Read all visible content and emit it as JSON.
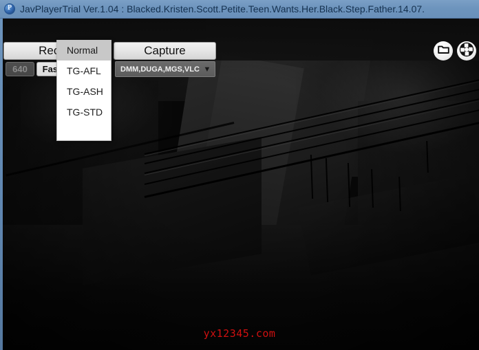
{
  "window": {
    "title": "JavPlayerTrial Ver.1.04 : Blacked.Kristen.Scott.Petite.Teen.Wants.Her.Black.Step.Father.14.07.",
    "app_icon": "player-app-icon",
    "titlebar_color": "#6d94bd",
    "background_color": "#0a0a0a"
  },
  "toolbar": {
    "record_label": "Record",
    "capture_label": "Capture",
    "resolution_value": "640",
    "speed_label": "Fast",
    "site_combobox": {
      "value": "DMM,DUGA,MGS,VLC",
      "arrow": "▼",
      "options": [
        "DMM,DUGA,MGS,VLC"
      ]
    },
    "open_folder_icon": "folder-icon",
    "move_pad_icon": "move-pad-icon"
  },
  "record_mode_menu": {
    "open": true,
    "selected": "Normal",
    "items": [
      {
        "label": "Normal",
        "selected": true
      },
      {
        "label": "TG-AFL",
        "selected": false
      },
      {
        "label": "TG-ASH",
        "selected": false
      },
      {
        "label": "TG-STD",
        "selected": false
      }
    ]
  },
  "video": {
    "watermark": "yx12345.com",
    "watermark_color": "#d01010",
    "description": "dark architectural scene with diagonal railing and staircase"
  }
}
